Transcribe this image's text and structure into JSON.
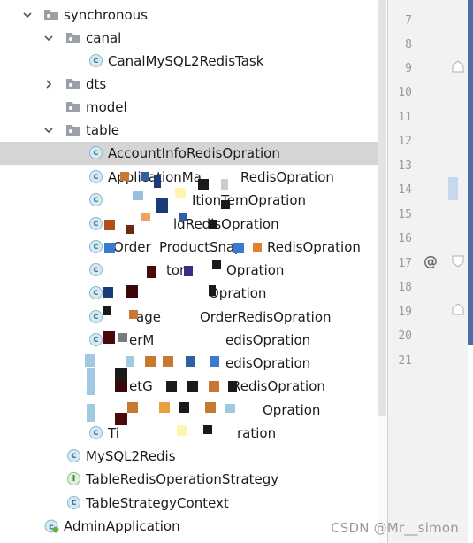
{
  "tree": [
    {
      "label": "synchronous",
      "kind": "package",
      "arrow": "expanded",
      "depth": 0
    },
    {
      "label": "canal",
      "kind": "package",
      "arrow": "expanded",
      "depth": 1
    },
    {
      "label": "CanalMySQL2RedisTask",
      "kind": "class",
      "depth": 2
    },
    {
      "label": "dts",
      "kind": "package",
      "arrow": "collapsed",
      "depth": 1
    },
    {
      "label": "model",
      "kind": "package",
      "arrow": "none",
      "depth": 1
    },
    {
      "label": "table",
      "kind": "package",
      "arrow": "expanded",
      "depth": 1
    },
    {
      "label": "AccountInfoRedisOpration",
      "kind": "class",
      "depth": 2,
      "selected": true
    },
    {
      "label": "ApplicationMa",
      "label2": "RedisOpration",
      "kind": "class",
      "depth": 2
    },
    {
      "label": "",
      "label2": "ItionTemOpration",
      "kind": "class",
      "depth": 2
    },
    {
      "label": "",
      "label2": "ldRedisOpration",
      "kind": "class",
      "depth": 2
    },
    {
      "label": "Order",
      "label2": "ProductSnap",
      "label3": "RedisOpration",
      "kind": "class",
      "depth": 2
    },
    {
      "label": "",
      "label2": "tor",
      "label3": "Opration",
      "kind": "class",
      "depth": 2
    },
    {
      "label": "",
      "label2": "Opration",
      "kind": "class",
      "depth": 2
    },
    {
      "label": "age",
      "label2": "OrderRedisOpration",
      "kind": "class",
      "depth": 2
    },
    {
      "label": "erM",
      "label2": "edisOpration",
      "kind": "class",
      "depth": 2
    },
    {
      "label": "",
      "label2": "edisOpration",
      "kind": "class",
      "depth": 2
    },
    {
      "label": "etG",
      "label2": "RedisOpration",
      "kind": "class",
      "depth": 2
    },
    {
      "label": "",
      "label2": "Opration",
      "kind": "class",
      "depth": 2
    },
    {
      "label": "Ti",
      "label2": "ration",
      "kind": "class",
      "depth": 2
    },
    {
      "label": "MySQL2Redis",
      "kind": "class",
      "depth": 1
    },
    {
      "label": "TableRedisOperationStrategy",
      "kind": "interface",
      "depth": 1
    },
    {
      "label": "TableStrategyContext",
      "kind": "class",
      "depth": 1
    },
    {
      "label": "AdminApplication",
      "kind": "app",
      "depth": 0
    }
  ],
  "line_numbers": [
    "7",
    "8",
    "9",
    "10",
    "11",
    "12",
    "13",
    "14",
    "15",
    "16",
    "17",
    "18",
    "19",
    "20",
    "21"
  ],
  "gutter_marker": "@",
  "watermark": "CSDN @Mr__simon",
  "colors": {
    "selection": "#d5d5d5",
    "class_icon": "#d6e9f2",
    "folder": "#8a8f96",
    "editor_strip": "#4a6ea9"
  }
}
